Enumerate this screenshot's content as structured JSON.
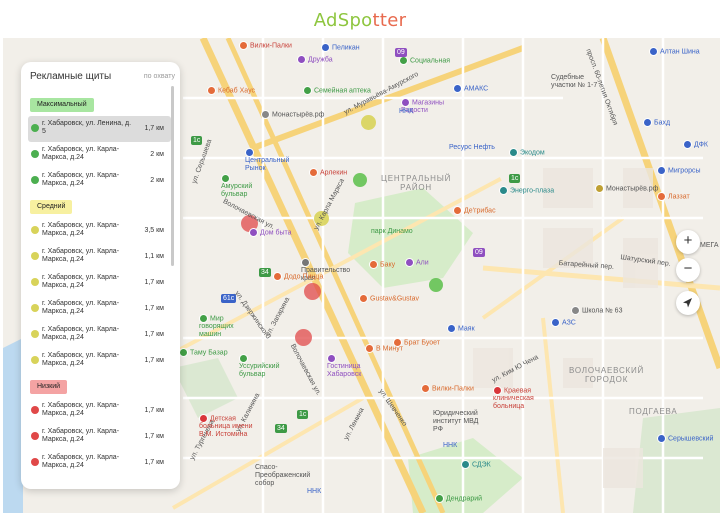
{
  "app": {
    "logo_part1": "AdSpo",
    "logo_part2": "tter"
  },
  "panel": {
    "title": "Рекламные щиты",
    "sort_label": "по охвату",
    "categories": [
      {
        "label": "Максимальный",
        "color": "#a8e6a1",
        "dot_color": "#4caf50",
        "items": [
          {
            "address": "г. Хабаровск, ул. Ленина, д. 5",
            "distance": "1,7 км",
            "selected": true
          },
          {
            "address": "г. Хабаровск, ул. Карла-Маркса, д.24",
            "distance": "2 км"
          },
          {
            "address": "г. Хабаровск, ул. Карла-Маркса, д.24",
            "distance": "2 км"
          }
        ]
      },
      {
        "label": "Средний",
        "color": "#f7f0a0",
        "dot_color": "#d8d35a",
        "items": [
          {
            "address": "г. Хабаровск, ул. Карла-Маркса, д.24",
            "distance": "3,5 км"
          },
          {
            "address": "г. Хабаровск, ул. Карла-Маркса, д.24",
            "distance": "1,1 км"
          },
          {
            "address": "г. Хабаровск, ул. Карла-Маркса, д.24",
            "distance": "1,7 км"
          },
          {
            "address": "г. Хабаровск, ул. Карла-Маркса, д.24",
            "distance": "1,7 км"
          },
          {
            "address": "г. Хабаровск, ул. Карла-Маркса, д.24",
            "distance": "1,7 км"
          },
          {
            "address": "г. Хабаровск, ул. Карла-Маркса, д.24",
            "distance": "1,7 км"
          }
        ]
      },
      {
        "label": "Низкий",
        "color": "#f4a3a3",
        "dot_color": "#e04848",
        "items": [
          {
            "address": "г. Хабаровск, ул. Карла-Маркса, д.24",
            "distance": "1,7 км"
          },
          {
            "address": "г. Хабаровск, ул. Карла-Маркса, д.24",
            "distance": "1,7 км"
          },
          {
            "address": "г. Хабаровск, ул. Карла-Маркса, д.24",
            "distance": "1,7 км"
          }
        ]
      }
    ]
  },
  "map": {
    "districts": {
      "central": "ЦЕНТРАЛЬНЫЙ\nРАЙОН",
      "voloch": "ВОЛОЧАЕВСКИЙ\nГОРОДОК",
      "podgaeva": "ПОДГАЕВА"
    },
    "pois": {
      "vilki_palki_top": "Вилки-Палки",
      "pelikan": "Пеликан",
      "duzhba": "Дружба",
      "socialnaya": "Социальная",
      "semeynaya": "Семейная аптека",
      "amaks": "АМАКС",
      "magaziny": "Магазины Радости",
      "nnk_top": "ННК",
      "kebab": "Кебаб Хаус",
      "monastyrev_left": "Монастырёв.рф",
      "altan": "Алтан Шина",
      "sudebnye": "Судебные участки № 1-7",
      "bakhd": "Бахд",
      "dfk": "ДФК",
      "resurs": "Ресурс Нефть",
      "ekodom": "Экодом",
      "energo": "Энерго-плаза",
      "monastyrev_right": "Монастырёв.рф",
      "migrorsy": "Мигрорсы",
      "lazzat": "Лаззат",
      "central_rynok": "Центральный Рынок",
      "arlekin": "Арлекин",
      "amursky": "Амурский бульвар",
      "dom_byta": "Дом быта",
      "park_dinamo": "парк Динамо",
      "degribas": "Де'грибас",
      "pravitelstvo": "Правительство края",
      "dodo": "Додо Пицца",
      "baku": "Баку",
      "ali": "Али",
      "gustav": "Gustav&Gustav",
      "mir_gov": "Мир говорящих машин",
      "tamu_bazar": "Таму Базар",
      "maya": "Маяк",
      "school": "Школа № 63",
      "azs": "АЗС",
      "minut": "В Минут",
      "brat_buoet": "Брат Буоет",
      "ussuriysky": "Уссурийский бульвар",
      "gostinica": "Гостиница Хабаровск",
      "vilki_palki_bottom": "Вилки-Палки",
      "kraevaya": "Краевая клиническая больница",
      "yuridicheskiy": "Юридический институт МВД РФ",
      "detskaya": "Детская больница имени В.М. Истомина",
      "nnk_bottom": "ННК",
      "sdek": "СДЭК",
      "spaso": "Спасо-Преображенский собор",
      "nnk_bottom2": "ННК",
      "dendrariy": "Дендрарий",
      "serysheva": "Серышевский",
      "mega": "МЕГА"
    },
    "streets": {
      "k_marksa": "ул. Карла Маркса",
      "volochaevskaya": "Волочаевская ул.",
      "volochaevskaya2": "Волочаевская ул.",
      "dzerzhinskogo": "ул. Дзержинского",
      "zaparina": "ул. Запарина",
      "muravyeva": "ул. Муравьёва-Амурского",
      "shevchenko": "ул. Шевченко",
      "oktyabrya": "просп. 60-летия Октября",
      "batareyny": "Батарейный пер.",
      "shaturskiy": "Шатурский пер.",
      "turgeneva": "ул. Тургенева",
      "kalinina": "ул. Калинина",
      "lenina": "ул. Ленина",
      "kim": "ул. Ким Ю Чена",
      "seryshev": "ул. Серышева"
    },
    "heatmap_colors": {
      "green": "#5cc04a",
      "yellow": "#d7d150",
      "red": "#e04a4a"
    },
    "controls": {
      "zoom_in": "+",
      "zoom_out": "−",
      "locate_icon": "navigation-arrow-icon"
    },
    "badges": {
      "b1": "1c",
      "b2": "34",
      "b3": "61c",
      "b4": "1c",
      "b5": "34",
      "b6": "1c",
      "b7": "09",
      "b8": "09"
    }
  }
}
